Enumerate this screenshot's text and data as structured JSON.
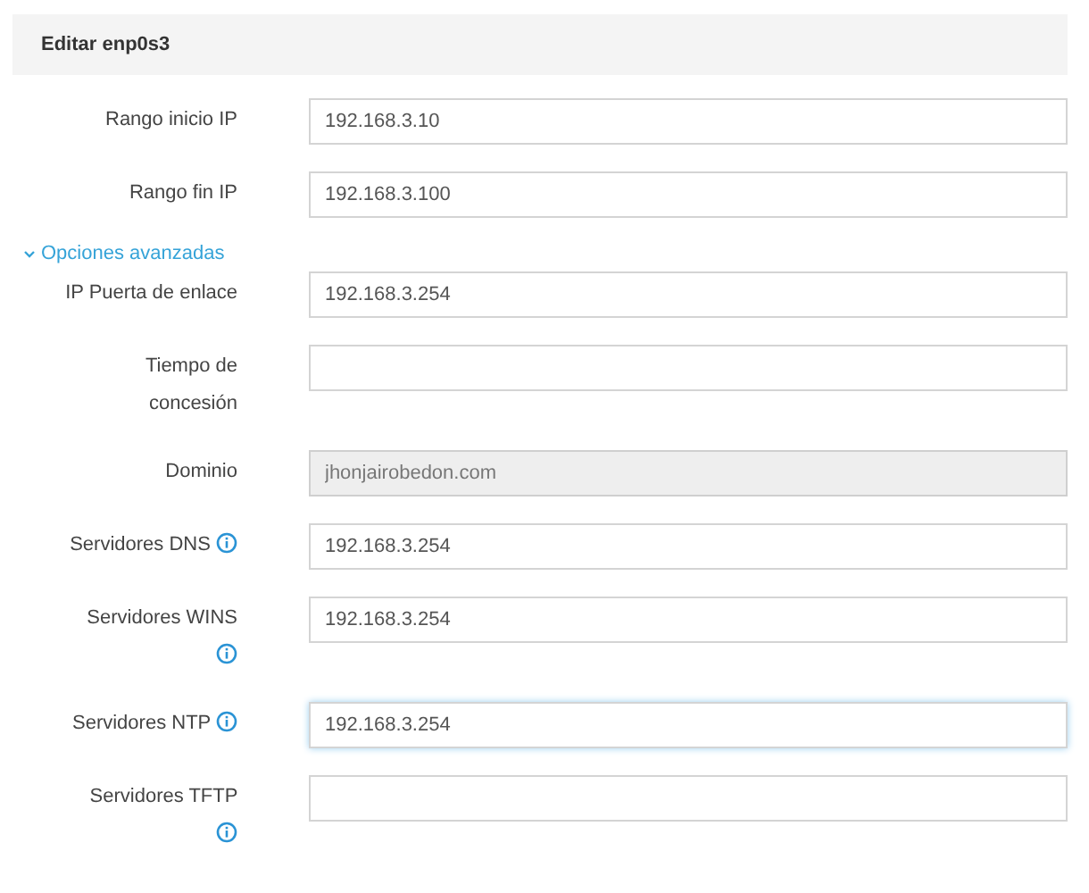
{
  "panel": {
    "title": "Editar enp0s3"
  },
  "fields": [
    {
      "label": "Rango inicio IP",
      "value": "192.168.3.10",
      "info": false,
      "disabled": false,
      "focused": false
    },
    {
      "label": "Rango fin IP",
      "value": "192.168.3.100",
      "info": false,
      "disabled": false,
      "focused": false
    }
  ],
  "advanced": {
    "label": "Opciones avanzadas",
    "expanded": true
  },
  "advanced_fields": [
    {
      "label": "IP Puerta de enlace",
      "value": "192.168.3.254",
      "info": false,
      "disabled": false,
      "focused": false
    },
    {
      "label": "Tiempo de concesión",
      "info": false,
      "disabled": false,
      "focused": false
    },
    {
      "label": "Dominio",
      "value": "jhonjairobedon.com",
      "info": false,
      "disabled": true,
      "focused": false
    },
    {
      "label": "Servidores DNS",
      "value": "192.168.3.254",
      "info": true,
      "disabled": false,
      "focused": false
    },
    {
      "label": "Servidores WINS",
      "value": "192.168.3.254",
      "info": true,
      "disabled": false,
      "focused": false
    },
    {
      "label": "Servidores NTP",
      "value": "192.168.3.254",
      "info": true,
      "disabled": false,
      "focused": true
    },
    {
      "label": "Servidores TFTP",
      "info": true,
      "disabled": false,
      "focused": false
    }
  ]
}
